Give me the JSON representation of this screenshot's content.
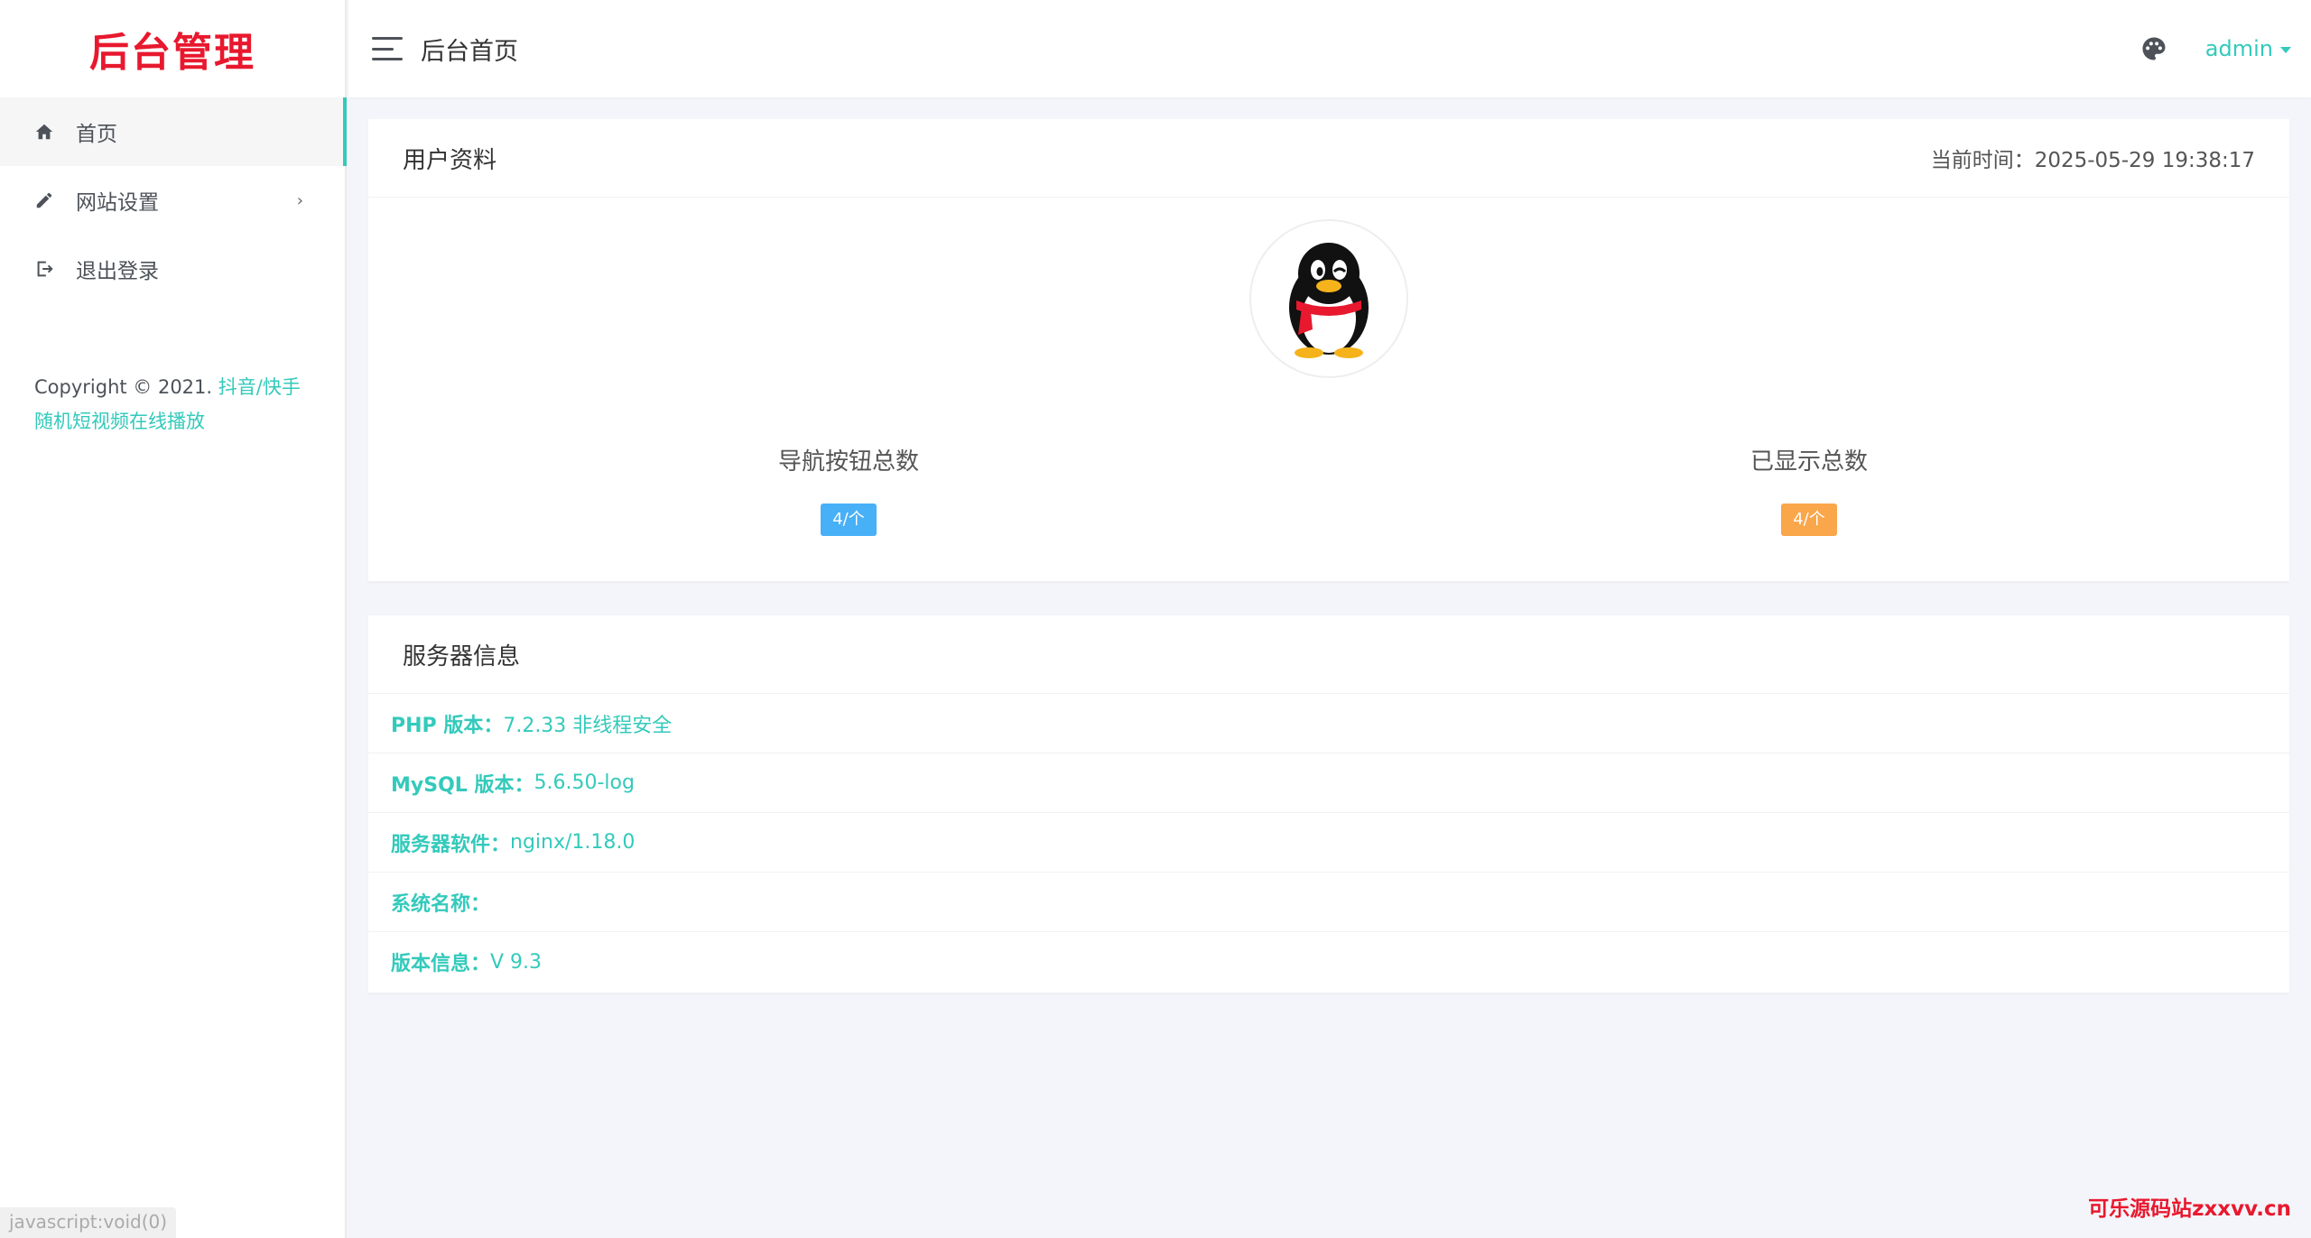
{
  "sidebar": {
    "logo": "后台管理",
    "items": [
      {
        "label": "首页",
        "icon": "home-icon"
      },
      {
        "label": "网站设置",
        "icon": "pencil-icon",
        "arrow": "›"
      },
      {
        "label": "退出登录",
        "icon": "logout-icon"
      }
    ],
    "copyright_prefix": "Copyright © 2021.",
    "copyright_link": "抖音/快手随机短视频在线播放"
  },
  "status_bar": "javascript:void(0)",
  "header": {
    "title": "后台首页",
    "user": "admin"
  },
  "profile_card": {
    "title": "用户资料",
    "time_label": "当前时间：",
    "time_value": "2025-05-29 19:38:17",
    "stats": [
      {
        "label": "导航按钮总数",
        "badge": "4/个",
        "color": "#48b0f7"
      },
      {
        "label": "已显示总数",
        "badge": "4/个",
        "color": "#faa64b"
      }
    ]
  },
  "server_card": {
    "title": "服务器信息",
    "rows": [
      {
        "key": "PHP 版本：",
        "value": "7.2.33 非线程安全"
      },
      {
        "key": "MySQL 版本：",
        "value": "5.6.50-log"
      },
      {
        "key": "服务器软件：",
        "value": "nginx/1.18.0"
      },
      {
        "key": "系统名称：",
        "value": ""
      },
      {
        "key": "版本信息：",
        "value": "V 9.3"
      }
    ]
  },
  "watermark": "可乐源码站zxxvv.cn",
  "colors": {
    "accent": "#33cabb",
    "logo": "#e8182e",
    "badge_blue": "#48b0f7",
    "badge_orange": "#faa64b"
  }
}
